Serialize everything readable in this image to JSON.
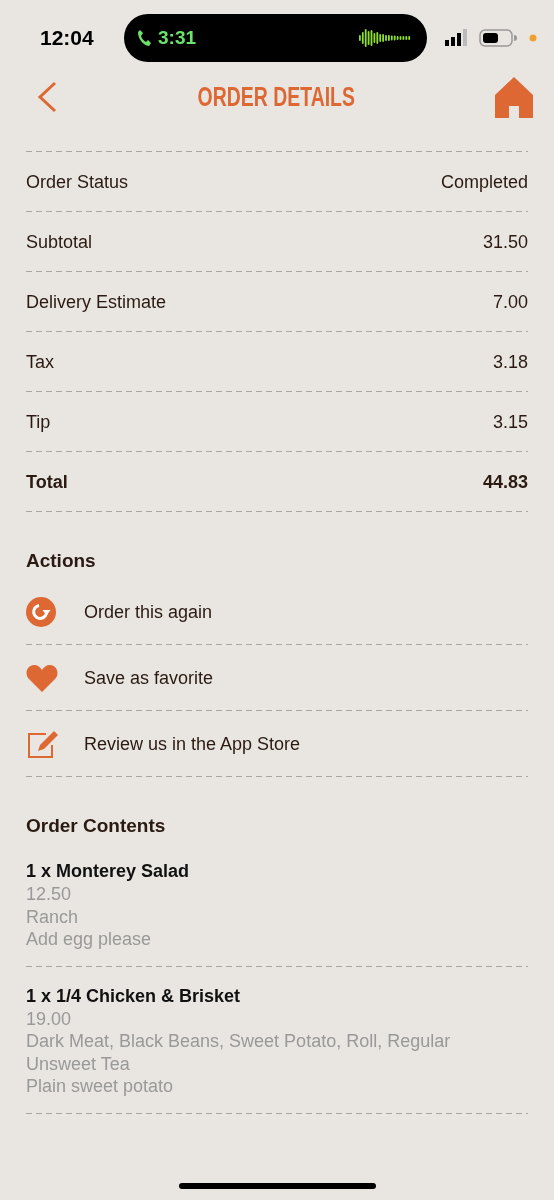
{
  "status_bar": {
    "time": "12:04",
    "call_time": "3:31"
  },
  "header": {
    "title": "ORDER DETAILS"
  },
  "details": [
    {
      "label": "Order Status",
      "value": "Completed",
      "kind": "row"
    },
    {
      "label": "Subtotal",
      "value": "31.50",
      "kind": "row"
    },
    {
      "label": "Delivery Estimate",
      "value": "7.00",
      "kind": "row"
    },
    {
      "label": "Tax",
      "value": "3.18",
      "kind": "row"
    },
    {
      "label": "Tip",
      "value": "3.15",
      "kind": "row"
    },
    {
      "label": "Total",
      "value": "44.83",
      "kind": "total"
    }
  ],
  "actions": {
    "title": "Actions",
    "items": [
      {
        "label": "Order this again",
        "kind": "reorder"
      },
      {
        "label": "Save as favorite",
        "kind": "favorite"
      },
      {
        "label": "Review us in the App Store",
        "kind": "review"
      }
    ]
  },
  "order_contents": {
    "title": "Order Contents",
    "items": [
      {
        "name": "1 x Monterey Salad",
        "price": "12.50",
        "notes": [
          "Ranch",
          "Add egg please"
        ]
      },
      {
        "name": "1 x 1/4 Chicken & Brisket",
        "price": "19.00",
        "notes": [
          "Dark Meat, Black Beans, Sweet Potato, Roll, Regular Unsweet Tea",
          "Plain sweet potato"
        ]
      }
    ]
  }
}
